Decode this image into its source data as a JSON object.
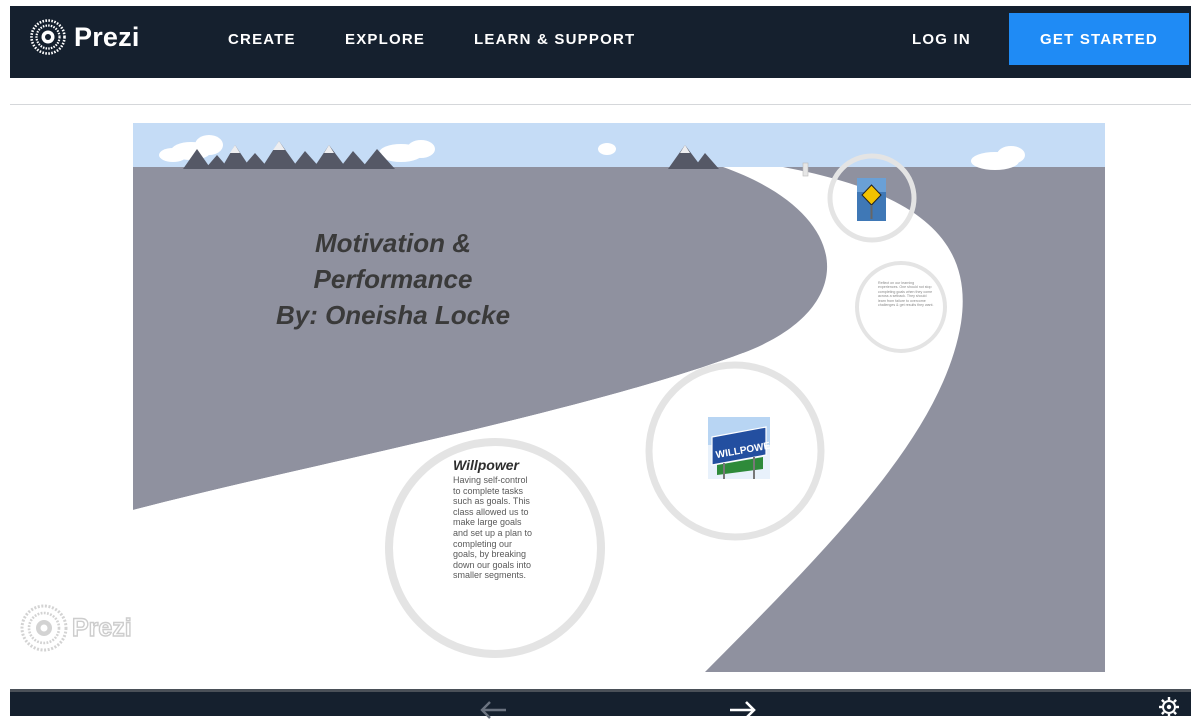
{
  "header": {
    "logo_text": "Prezi",
    "nav": {
      "create": "CREATE",
      "explore": "EXPLORE",
      "learn_support": "LEARN & SUPPORT",
      "login": "LOG IN"
    },
    "cta_label": "GET STARTED"
  },
  "slide": {
    "title_lines": [
      "Motivation &",
      "Performance",
      "By: Oneisha Locke"
    ],
    "willpower": {
      "heading": "Willpower",
      "body": "Having self-control to complete tasks such as goals. This class allowed us to make large goals and set up a plan to completing our goals, by breaking down our goals into smaller segments."
    },
    "small_circle_text": "Reflect on our learning experiences. One should not stop completing goals when they come across a setback. They should learn from failure to overcome challenges & get results they want.",
    "images": {
      "sign_image": "warning-road-sign-image",
      "willpower_image": "willpower-road-sign-image"
    },
    "watermark_text": "Prezi"
  },
  "controls": {
    "prev_icon": "arrow-left-icon",
    "next_icon": "arrow-right-icon",
    "settings_icon": "gear-icon"
  },
  "colors": {
    "nav_bg": "#15202e",
    "cta_bg": "#1f8bf5",
    "sky": "#c5dcf6",
    "ground": "#8f919f",
    "mountains": "#555866",
    "road": "#ffffff"
  }
}
